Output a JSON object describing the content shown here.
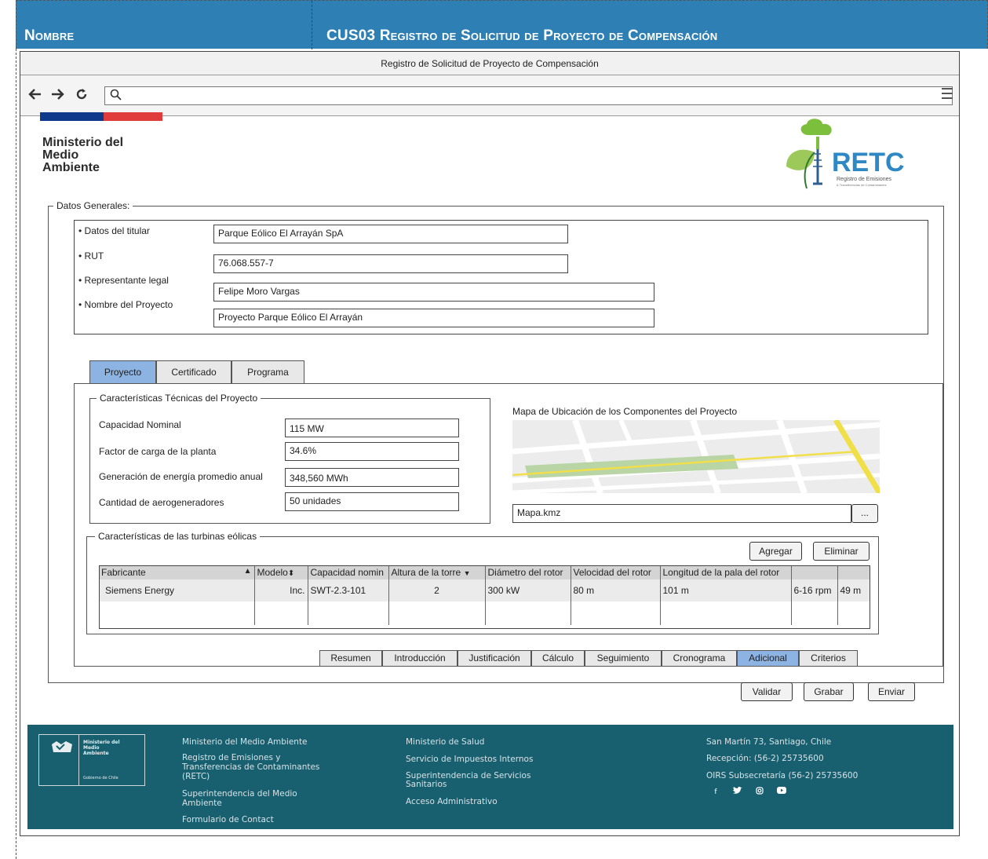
{
  "doc_header": {
    "label_left": "Nombre",
    "label_right": "CUS03 Registro de Solicitud de Proyecto de Compensación",
    "bg_color": "#2e7fb4"
  },
  "window": {
    "title": "Registro de Solicitud  de Proyecto de Compensación"
  },
  "browser": {
    "icons": [
      "back-arrow-icon",
      "forward-arrow-icon",
      "reload-icon",
      "search-icon",
      "menu-icon"
    ]
  },
  "brand": {
    "ministry_line1": "Ministerio del",
    "ministry_line2": "Medio",
    "ministry_line3": "Ambiente",
    "retc_text": "RETC",
    "retc_sub1": "Registro de Emisiones",
    "retc_sub2": "& Transferencias de Contaminantes",
    "flag_colors": [
      "#0f3a8b",
      "#e03c3c"
    ]
  },
  "datos_generales": {
    "legend": "Datos Generales:",
    "labels": [
      "• Datos del titular",
      "• RUT",
      "• Representante legal",
      "• Nombre del Proyecto"
    ],
    "values": [
      "Parque Eólico El Arrayán SpA",
      "76.068.557-7",
      "Felipe Moro Vargas",
      "Proyecto Parque Eólico El Arrayán"
    ]
  },
  "tabs": {
    "items": [
      "Proyecto",
      "Certificado",
      "Programa"
    ],
    "active": "Proyecto"
  },
  "caracteristicas": {
    "legend": "Características Técnicas del Proyecto",
    "labels": [
      "Capacidad Nominal",
      "Factor de carga de la planta",
      "Generación de energía promedio anual",
      "Cantidad de aerogeneradores"
    ],
    "values": [
      "115 MW",
      "34.6%",
      "348,560 MWh",
      "50 unidades"
    ]
  },
  "mapa": {
    "title": "Mapa de Ubicación de los Componentes del Proyecto",
    "file_value": "Mapa.kmz",
    "browse_label": "..."
  },
  "turbinas": {
    "legend": "Características de las turbinas eólicas",
    "add_label": "Agregar",
    "delete_label": "Eliminar",
    "columns": [
      "Fabricante",
      "Modelo",
      "Capacidad nomin",
      "Altura de la torre",
      "Diámetro del rotor",
      "Velocidad del rotor",
      "Longitud de la pala del rotor",
      "",
      ""
    ],
    "rows": [
      [
        "Siemens Energy",
        "Inc.",
        "SWT-2.3-101",
        "2",
        "300 kW",
        "80 m",
        "101 m",
        "6-16 rpm",
        "49 m"
      ]
    ]
  },
  "bottom_tabs": {
    "items": [
      "Resumen",
      "Introducción",
      "Justificación",
      "Cálculo",
      "Seguimiento",
      "Cronograma",
      "Adicional",
      "Criterios"
    ],
    "active": "Adicional"
  },
  "actions": {
    "validate_label": "Validar",
    "save_label": "Grabar",
    "send_label": "Enviar"
  },
  "footer": {
    "logo_line1": "Ministerio del",
    "logo_line2": "Medio",
    "logo_line3": "Ambiente",
    "logo_gob": "Gobierno de Chile",
    "col1": [
      "Ministerio del Medio Ambiente",
      "Registro de Emisiones y",
      "Transferencias de Contaminantes",
      "(RETC)",
      "Superintendencia del Medio",
      "Ambiente",
      "Formulario de Contact"
    ],
    "col2": [
      "Ministerio de Salud",
      "Servicio de Impuestos Internos",
      "Superintendencia de Servicios",
      "Sanitarios",
      "Acceso Administrativo"
    ],
    "col3": [
      "San Martín 73, Santiago, Chile",
      "Recepción: (56-2) 25735600",
      "OIRS Subsecretaría (56-2) 25735600"
    ],
    "social": [
      "facebook-icon",
      "twitter-icon",
      "instagram-icon",
      "youtube-icon"
    ],
    "bg_color": "#18606f"
  }
}
